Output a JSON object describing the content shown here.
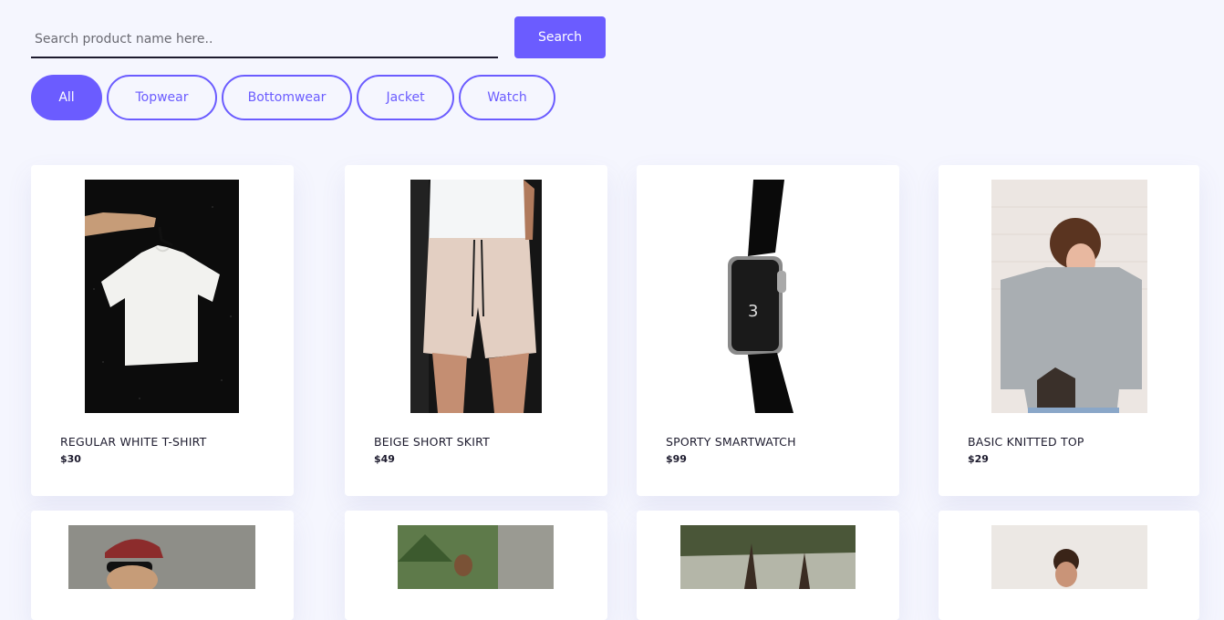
{
  "search": {
    "placeholder": "Search product name here..",
    "button_label": "Search"
  },
  "filters": [
    {
      "label": "All",
      "active": true
    },
    {
      "label": "Topwear",
      "active": false
    },
    {
      "label": "Bottomwear",
      "active": false
    },
    {
      "label": "Jacket",
      "active": false
    },
    {
      "label": "Watch",
      "active": false
    }
  ],
  "products": [
    {
      "name": "REGULAR WHITE T-SHIRT",
      "price": "$30"
    },
    {
      "name": "BEIGE SHORT SKIRT",
      "price": "$49"
    },
    {
      "name": "SPORTY SMARTWATCH",
      "price": "$99"
    },
    {
      "name": "BASIC KNITTED TOP",
      "price": "$29"
    }
  ],
  "colors": {
    "accent": "#6b5cff",
    "background": "#f5f6fe",
    "text": "#1d1b2e"
  }
}
